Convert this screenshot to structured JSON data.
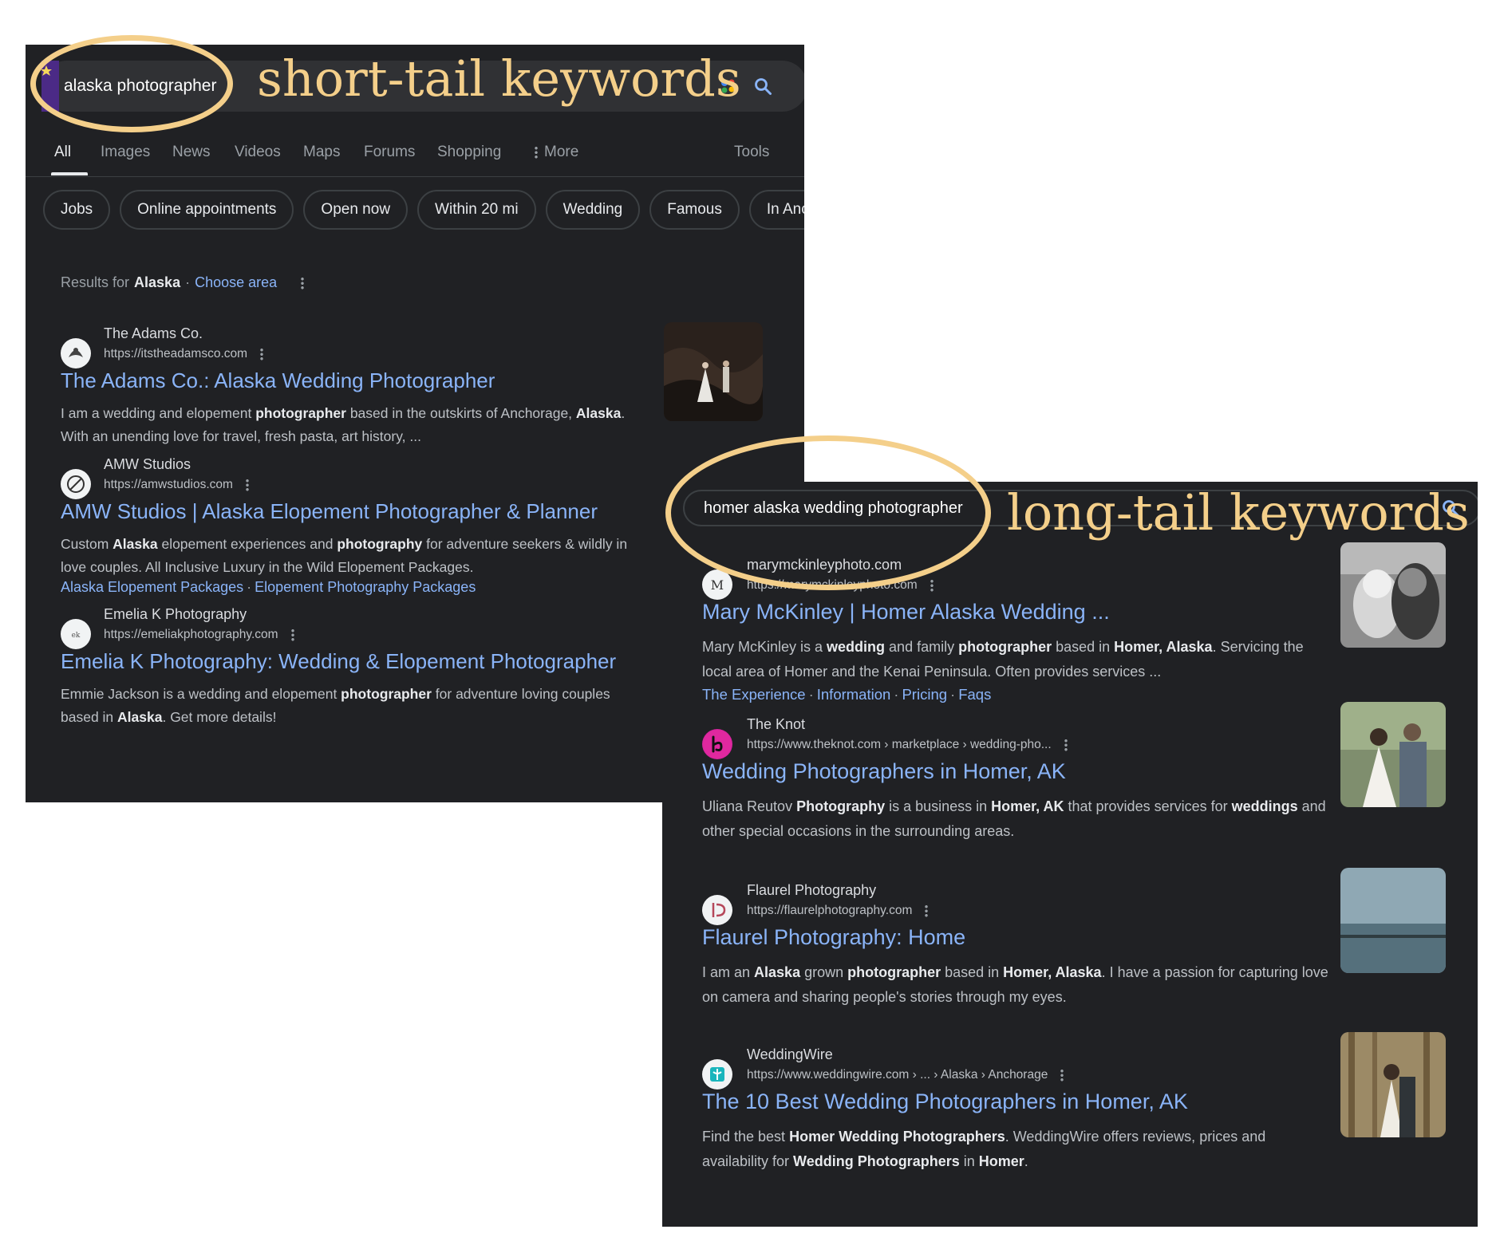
{
  "annotations": {
    "short_label": "short-tail keywords",
    "long_label": "long-tail keywords",
    "accent_color": "#f4cf8a"
  },
  "short": {
    "query": "alaska photographer",
    "tabs": [
      "All",
      "Images",
      "News",
      "Videos",
      "Maps",
      "Forums",
      "Shopping",
      "More",
      "Tools"
    ],
    "active_tab": "All",
    "chips": [
      "Jobs",
      "Online appointments",
      "Open now",
      "Within 20 mi",
      "Wedding",
      "Famous",
      "In Ancho"
    ],
    "results_for": {
      "prefix": "Results for",
      "place": "Alaska",
      "sep": "·",
      "action": "Choose area"
    },
    "results": [
      {
        "site": "The Adams Co.",
        "url": "https://itstheadamsco.com",
        "title": "The Adams Co.: Alaska Wedding Photographer",
        "snippet": [
          "I am a wedding and elopement ",
          "photographer",
          " based in the outskirts of Anchorage, ",
          "Alaska",
          ". With an unending love for travel, fresh pasta, art history, ..."
        ],
        "sitelinks": []
      },
      {
        "site": "AMW Studios",
        "url": "https://amwstudios.com",
        "title": "AMW Studios | Alaska Elopement Photographer & Planner",
        "snippet": [
          "Custom ",
          "Alaska",
          " elopement experiences and ",
          "photography",
          " for adventure seekers & wildly in love couples. All Inclusive Luxury in the Wild Elopement Packages."
        ],
        "sitelinks": [
          "Alaska Elopement Packages",
          "Elopement Photography Packages"
        ]
      },
      {
        "site": "Emelia K Photography",
        "url": "https://emeliakphotography.com",
        "title": "Emelia K Photography: Wedding & Elopement Photographer",
        "snippet": [
          "Emmie Jackson is a wedding and elopement ",
          "photographer",
          " for adventure loving couples based in ",
          "Alaska",
          ". Get more details!"
        ],
        "sitelinks": []
      }
    ]
  },
  "long": {
    "query": "homer alaska wedding photographer",
    "results": [
      {
        "site": "marymckinleyphoto.com",
        "url": "https://marymckinleyphoto.com",
        "title": "Mary McKinley | Homer Alaska Wedding ...",
        "snippet": [
          "Mary McKinley is a ",
          "wedding",
          " and family ",
          "photographer",
          " based in ",
          "Homer, Alaska",
          ". Servicing the local area of Homer and the Kenai Peninsula. Often provides services ..."
        ],
        "sitelinks": [
          "The Experience",
          "Information",
          "Pricing",
          "Faqs"
        ]
      },
      {
        "site": "The Knot",
        "url": "https://www.theknot.com › marketplace › wedding-pho...",
        "title": "Wedding Photographers in Homer, AK",
        "snippet": [
          "Uliana Reutov ",
          "Photography",
          " is a business in ",
          "Homer, AK",
          " that provides services for ",
          "weddings",
          " and other special occasions in the surrounding areas."
        ],
        "sitelinks": []
      },
      {
        "site": "Flaurel Photography",
        "url": "https://flaurelphotography.com",
        "title": "Flaurel Photography: Home",
        "snippet": [
          "I am an ",
          "Alaska",
          " grown ",
          "photographer",
          " based in ",
          "Homer, Alaska",
          ". I have a passion for capturing love on camera and sharing people's stories through my eyes."
        ],
        "sitelinks": []
      },
      {
        "site": "WeddingWire",
        "url": "https://www.weddingwire.com › ... › Alaska › Anchorage",
        "title": "The 10 Best Wedding Photographers in Homer, AK",
        "snippet": [
          "Find the best ",
          "Homer Wedding Photographers",
          ". WeddingWire offers reviews, prices and availability for ",
          "Wedding Photographers",
          " in ",
          "Homer",
          "."
        ],
        "sitelinks": []
      }
    ]
  },
  "colors": {
    "background": "#202124",
    "link": "#8ab4f8",
    "text": "#e8eaed",
    "muted": "#bdc1c6"
  }
}
